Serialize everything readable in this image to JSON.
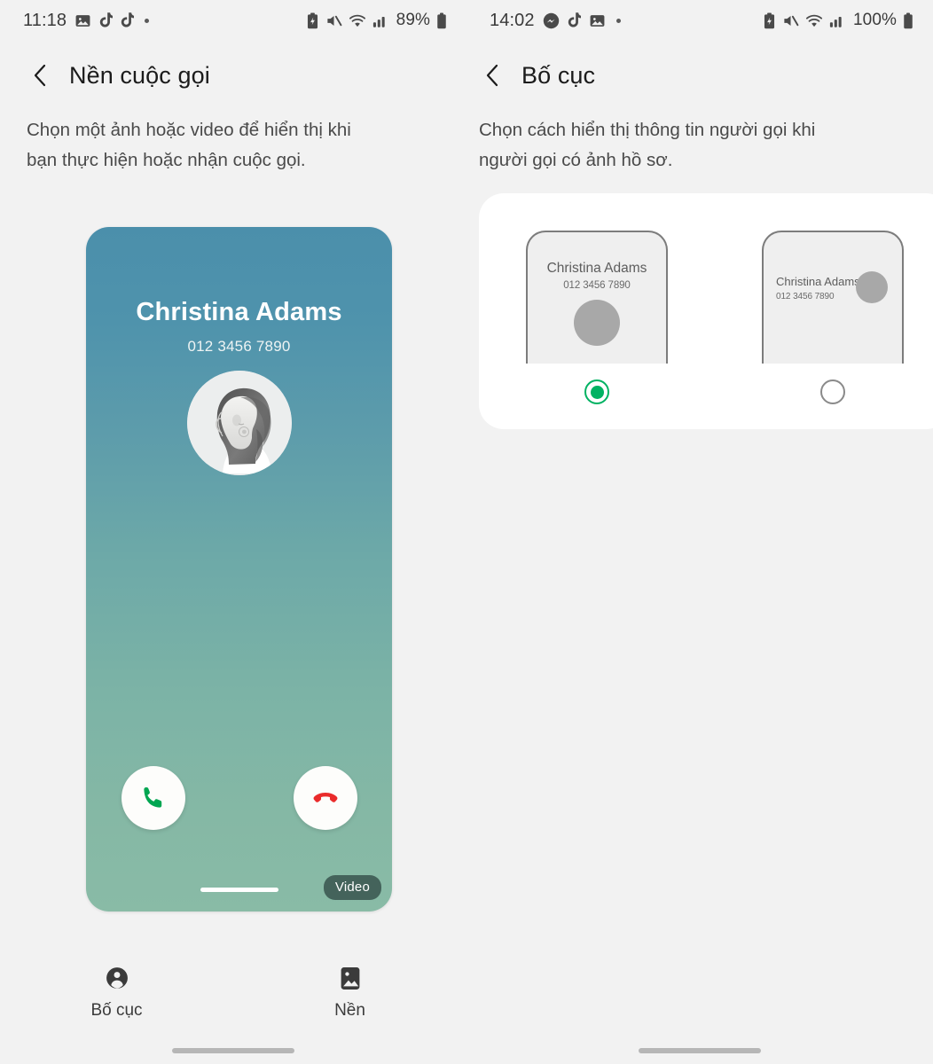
{
  "left": {
    "statusbar": {
      "time": "11:18",
      "left_icons": [
        "photos-icon",
        "tiktok-icon",
        "tiktok-icon",
        "more-dot-icon"
      ],
      "right_icons": [
        "battery-saver-icon",
        "mute-icon",
        "wifi-icon",
        "signal-icon"
      ],
      "battery": "89%"
    },
    "header": {
      "back_icon": "chevron-left-icon",
      "title": "Nền cuộc gọi"
    },
    "description": "Chọn một ảnh hoặc video để hiển thị khi bạn thực hiện hoặc nhận cuộc gọi.",
    "preview": {
      "contact_name": "Christina Adams",
      "contact_number": "012 3456 7890",
      "avatar_icon": "contact-photo",
      "answer_icon": "phone-answer-icon",
      "decline_icon": "phone-decline-icon",
      "video_badge": "Video",
      "gradient_top": "#4b8fab",
      "gradient_bottom": "#89bba6",
      "answer_color": "#00a651",
      "decline_color": "#ea2b2b"
    },
    "tabs": [
      {
        "label": "Bố cục",
        "icon": "person-icon"
      },
      {
        "label": "Nền",
        "icon": "image-icon"
      }
    ]
  },
  "right": {
    "statusbar": {
      "time": "14:02",
      "left_icons": [
        "messenger-icon",
        "tiktok-icon",
        "photos-icon",
        "more-dot-icon"
      ],
      "right_icons": [
        "battery-saver-icon",
        "mute-icon",
        "wifi-icon",
        "signal-icon"
      ],
      "battery": "100%"
    },
    "header": {
      "back_icon": "chevron-left-icon",
      "title": "Bố cục"
    },
    "description": "Chọn cách hiển thị thông tin người gọi khi người gọi có ảnh hồ sơ.",
    "options": [
      {
        "id": "centered",
        "contact_name": "Christina Adams",
        "contact_number": "012 3456 7890",
        "selected": true
      },
      {
        "id": "compact",
        "contact_name": "Christina Adams",
        "contact_number": "012 3456 7890",
        "selected": false
      }
    ],
    "accent_color": "#00b262"
  }
}
